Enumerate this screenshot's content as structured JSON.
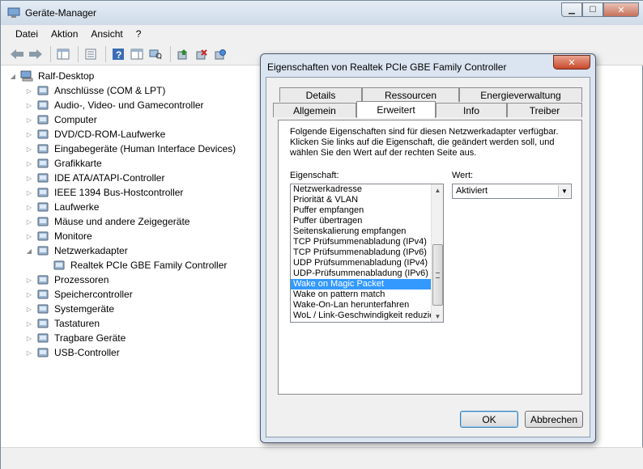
{
  "window": {
    "title": "Geräte-Manager",
    "buttons": {
      "minimize": "▁",
      "maximize": "☐",
      "close": "✕"
    }
  },
  "menubar": {
    "items": [
      "Datei",
      "Aktion",
      "Ansicht",
      "?"
    ]
  },
  "toolbar": {
    "icons": [
      "back-arrow-icon",
      "forward-arrow-icon",
      "show-hide-console-tree-icon",
      "properties-icon",
      "help-icon",
      "show-hide-action-pane-icon",
      "update-driver-icon",
      "uninstall-icon",
      "scan-hardware-changes-icon"
    ]
  },
  "tree": {
    "root": "Ralf-Desktop",
    "items": [
      {
        "label": "Anschlüsse (COM & LPT)",
        "icon": "port-icon",
        "expanded": false
      },
      {
        "label": "Audio-, Video- und Gamecontroller",
        "icon": "speaker-icon",
        "expanded": false
      },
      {
        "label": "Computer",
        "icon": "computer-icon",
        "expanded": false
      },
      {
        "label": "DVD/CD-ROM-Laufwerke",
        "icon": "disc-drive-icon",
        "expanded": false
      },
      {
        "label": "Eingabegeräte (Human Interface Devices)",
        "icon": "hid-icon",
        "expanded": false
      },
      {
        "label": "Grafikkarte",
        "icon": "display-adapter-icon",
        "expanded": false
      },
      {
        "label": "IDE ATA/ATAPI-Controller",
        "icon": "ide-controller-icon",
        "expanded": false
      },
      {
        "label": "IEEE 1394 Bus-Hostcontroller",
        "icon": "firewire-icon",
        "expanded": false
      },
      {
        "label": "Laufwerke",
        "icon": "disk-drive-icon",
        "expanded": false
      },
      {
        "label": "Mäuse und andere Zeigegeräte",
        "icon": "mouse-icon",
        "expanded": false
      },
      {
        "label": "Monitore",
        "icon": "monitor-icon",
        "expanded": false
      },
      {
        "label": "Netzwerkadapter",
        "icon": "network-adapter-icon",
        "expanded": true
      },
      {
        "label": "Realtek PCIe GBE Family Controller",
        "icon": "network-card-icon",
        "child": true
      },
      {
        "label": "Prozessoren",
        "icon": "processor-icon",
        "expanded": false
      },
      {
        "label": "Speichercontroller",
        "icon": "storage-controller-icon",
        "expanded": false
      },
      {
        "label": "Systemgeräte",
        "icon": "system-device-icon",
        "expanded": false
      },
      {
        "label": "Tastaturen",
        "icon": "keyboard-icon",
        "expanded": false
      },
      {
        "label": "Tragbare Geräte",
        "icon": "portable-device-icon",
        "expanded": false
      },
      {
        "label": "USB-Controller",
        "icon": "usb-icon",
        "expanded": false
      }
    ]
  },
  "dialog": {
    "title": "Eigenschaften von Realtek PCIe GBE Family Controller",
    "close": "✕",
    "tabs_back": [
      "Details",
      "Ressourcen",
      "Energieverwaltung"
    ],
    "tabs_front": [
      "Allgemein",
      "Erweitert",
      "Info",
      "Treiber"
    ],
    "active_tab": "Erweitert",
    "description": "Folgende Eigenschaften sind für diesen Netzwerkadapter verfügbar. Klicken Sie links auf die Eigenschaft, die geändert werden soll, und wählen Sie den Wert auf der rechten Seite aus.",
    "property_label": "Eigenschaft:",
    "value_label": "Wert:",
    "properties": [
      "Netzwerkadresse",
      "Priorität & VLAN",
      "Puffer empfangen",
      "Puffer übertragen",
      "Seitenskalierung empfangen",
      "TCP Prüfsummenabladung (IPv4)",
      "TCP Prüfsummenabladung (IPv6)",
      "UDP Prüfsummenabladung (IPv4)",
      "UDP-Prüfsummenabladung (IPv6)",
      "Wake on Magic Packet",
      "Wake on pattern match",
      "Wake-On-Lan herunterfahren",
      "WoL / Link-Geschwindigkeit reduzie"
    ],
    "selected_property": "Wake on Magic Packet",
    "value": "Aktiviert",
    "ok_label": "OK",
    "cancel_label": "Abbrechen"
  }
}
